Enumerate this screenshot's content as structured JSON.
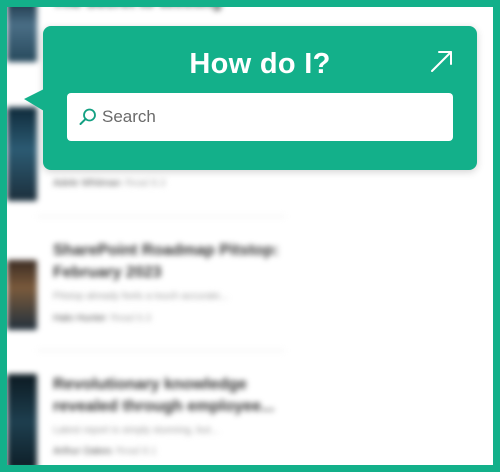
{
  "popup": {
    "title": "How do I?",
    "expand_icon": "arrow-up-right-icon",
    "search": {
      "icon": "search-icon",
      "placeholder": "Search",
      "value": ""
    },
    "accent_color": "#13b08a"
  },
  "feed": {
    "items": [
      {
        "title": "The Secret to Winning",
        "description": "",
        "author": "",
        "read_time": ""
      },
      {
        "title": "",
        "description": "",
        "author": "Adele Whitman",
        "read_time": "Read 8.3"
      },
      {
        "title": "SharePoint Roadmap Pitstop: February 2023",
        "description": "Pitstop already feels a touch accurate...",
        "author": "Halo Hunter",
        "read_time": "Read 6.3"
      },
      {
        "title": "Revolutionary knowledge revealed through employee...",
        "description": "Latest report is simply stunning, but...",
        "author": "Arthur Oakes",
        "read_time": "Read 8.1"
      }
    ]
  }
}
